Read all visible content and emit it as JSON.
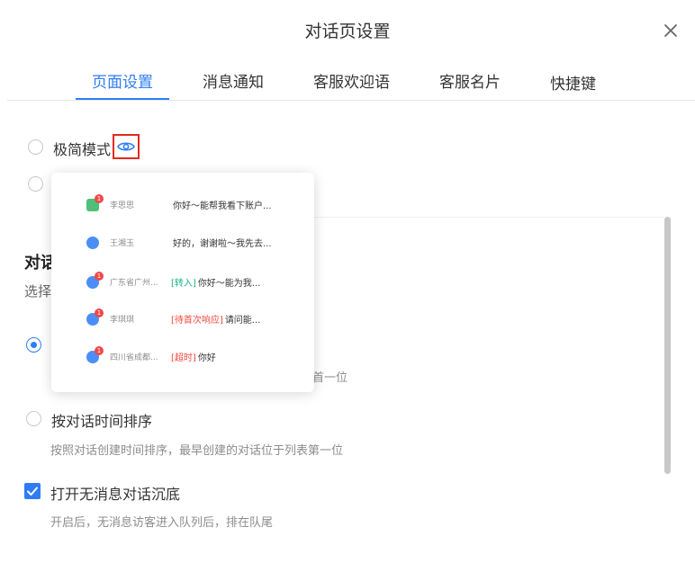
{
  "dialog": {
    "title": "对话页设置",
    "close_icon": "close-icon"
  },
  "tabs": [
    {
      "label": "页面设置",
      "active": true
    },
    {
      "label": "消息通知",
      "active": false
    },
    {
      "label": "客服欢迎语",
      "active": false
    },
    {
      "label": "客服名片",
      "active": false
    },
    {
      "label": "快捷键",
      "active": false
    }
  ],
  "mode": {
    "minimal_label": "极简模式",
    "preview_icon": "eye-icon",
    "minimal_selected": false,
    "second_selected": false
  },
  "preview_popup": {
    "rows": [
      {
        "name": "李思思",
        "avatar": "green",
        "badge": "1",
        "tag": "",
        "tag_color": "",
        "message": "你好～能帮我看下账户..."
      },
      {
        "name": "王湘玉",
        "avatar": "blue",
        "badge": "",
        "tag": "",
        "tag_color": "",
        "message": "好的，谢谢啦～我先去..."
      },
      {
        "name": "广东省广州...",
        "avatar": "blue",
        "badge": "1",
        "tag": "[转入]",
        "tag_color": "#1bb38a",
        "message": "你好～能为我..."
      },
      {
        "name": "李琪琪",
        "avatar": "blue",
        "badge": "1",
        "tag": "[待首次响应]",
        "tag_color": "#f0483e",
        "message": "请问能..."
      },
      {
        "name": "四川省成都...",
        "avatar": "blue",
        "badge": "1",
        "tag": "[超时]",
        "tag_color": "#f0483e",
        "message": "你好"
      }
    ]
  },
  "sort_section": {
    "title_visible": "对话",
    "subtitle_visible": "选择",
    "option1_selected": true,
    "option1_desc_visible": "首一位",
    "option2_label": "按对话时间排序",
    "option2_desc": "按照对话创建时间排序，最早创建的对话位于列表第一位",
    "option2_selected": false
  },
  "sink": {
    "label": "打开无消息对话沉底",
    "desc": "开启后，无消息访客进入队列后，排在队尾",
    "checked": true
  },
  "colors": {
    "accent": "#2e7df6",
    "highlight_border": "#e02b20"
  }
}
